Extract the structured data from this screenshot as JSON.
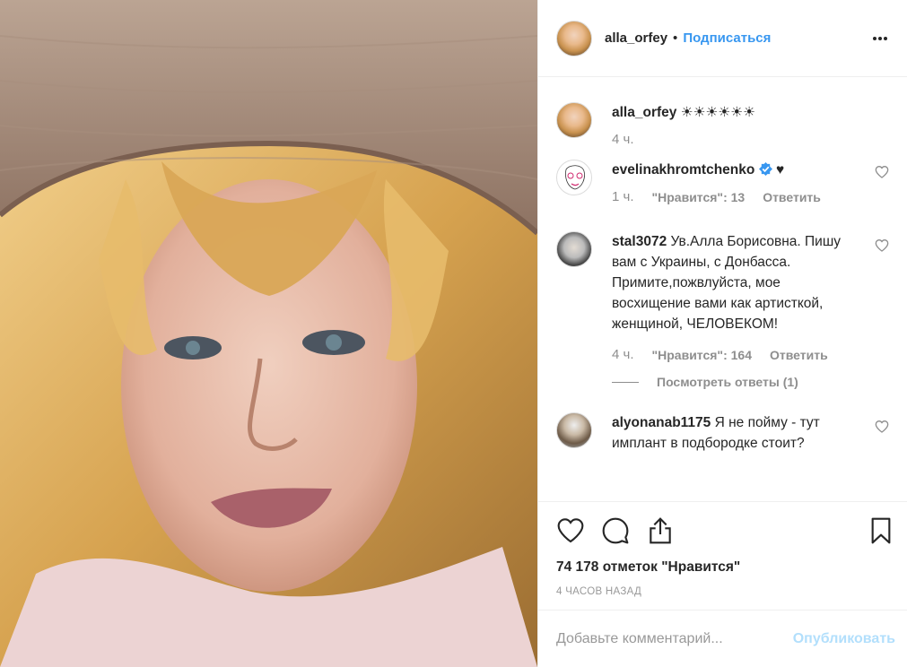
{
  "photo": {
    "alt_icon": "selfie-photo"
  },
  "header": {
    "username": "alla_orfey",
    "separator": "•",
    "follow_label": "Подписаться",
    "more_icon": "more-options-icon"
  },
  "caption": {
    "username": "alla_orfey",
    "text": "☀☀☀☀☀☀",
    "time": "4 ч."
  },
  "comments": [
    {
      "username": "evelinakhromtchenko",
      "verified": true,
      "text": "♥",
      "time": "1 ч.",
      "likes": "\"Нравится\": 13",
      "reply_label": "Ответить"
    },
    {
      "username": "stal3072",
      "text": "Ув.Алла Борисовна. Пишу вам с Украины, с Донбасса. Примите,пожвлуйста, мое восхищение вами как артисткой, женщиной, ЧЕЛОВЕКОМ!",
      "time": "4 ч.",
      "likes": "\"Нравится\": 164",
      "reply_label": "Ответить",
      "view_replies": "Посмотреть ответы (1)"
    },
    {
      "username": "alyonanab1175",
      "text": "Я не пойму - тут имплант в подбородке стоит?",
      "time": "",
      "likes": "",
      "reply_label": ""
    }
  ],
  "actions": {
    "likes_text": "74 178 отметок \"Нравится\"",
    "posted_ago": "4 ЧАСОВ НАЗАД"
  },
  "add_comment": {
    "placeholder": "Добавьте комментарий...",
    "post_label": "Опубликовать"
  },
  "colors": {
    "link_blue": "#3897f0",
    "post_disabled": "#b2dffc",
    "verified_blue": "#3897f0"
  }
}
